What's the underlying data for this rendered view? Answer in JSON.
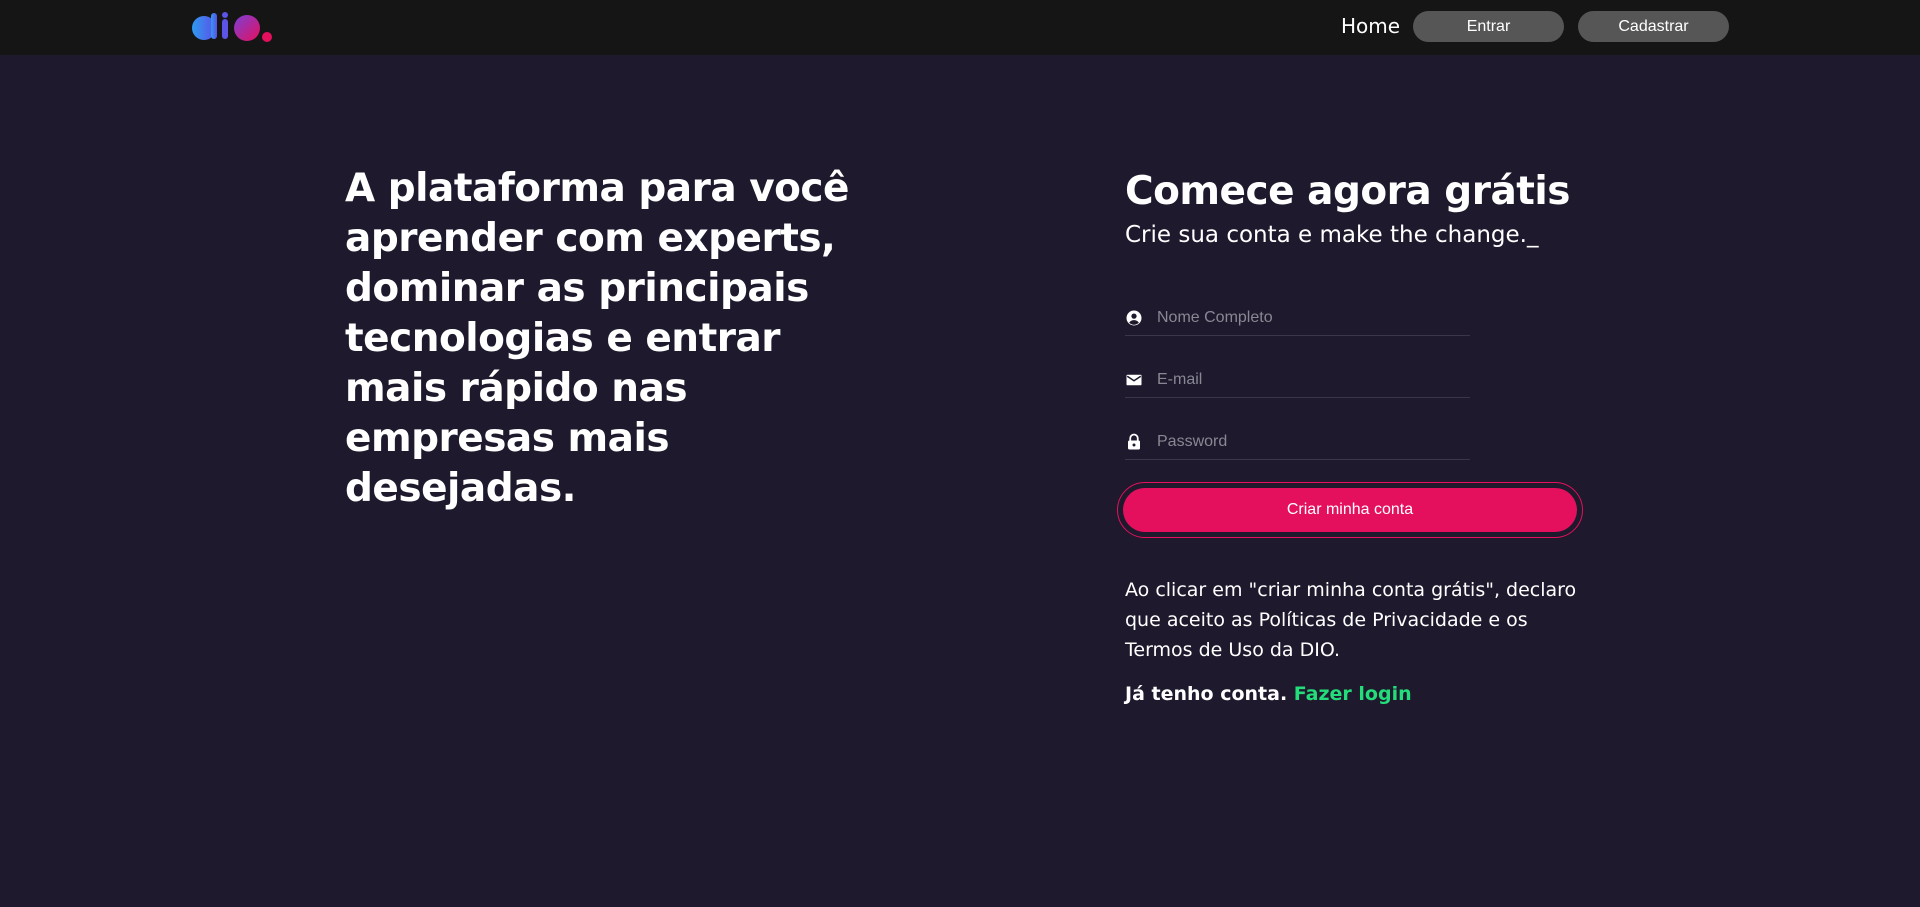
{
  "header": {
    "logo_text": "dio.",
    "nav": {
      "home_label": "Home",
      "login_label": "Entrar",
      "signup_label": "Cadastrar"
    }
  },
  "hero": {
    "title": "A plataforma para você aprender com experts, dominar as principais tecnologias e entrar mais rápido nas empresas mais desejadas."
  },
  "signup": {
    "title": "Comece agora grátis",
    "subtitle": "Crie sua conta e make the change._",
    "fields": {
      "name": {
        "placeholder": "Nome Completo",
        "value": ""
      },
      "email": {
        "placeholder": "E-mail",
        "value": ""
      },
      "password": {
        "placeholder": "Password",
        "value": ""
      }
    },
    "submit_label": "Criar minha conta",
    "terms": "Ao clicar em \"criar minha conta grátis\", declaro que aceito as Políticas de Privacidade e os Termos de Uso da DIO.",
    "have_account": "Já tenho conta.",
    "login_link": "Fazer login"
  },
  "colors": {
    "background": "#1e192c",
    "header": "#151515",
    "nav_button": "#565656",
    "accent": "#e4105d",
    "link": "#23dd7a"
  },
  "icons": {
    "name_field": "account-circle-icon",
    "email_field": "mail-icon",
    "password_field": "lock-icon"
  }
}
